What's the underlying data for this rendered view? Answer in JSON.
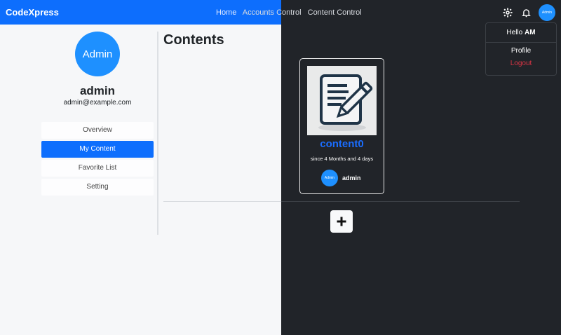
{
  "navbar": {
    "brand": "CodeXpress",
    "links": [
      "Home",
      "Accounts Control",
      "Content Control"
    ],
    "avatar_label": "Admin"
  },
  "dropdown": {
    "greeting_prefix": "Hello",
    "greeting_name": "AM",
    "profile": "Profile",
    "logout": "Logout"
  },
  "profile": {
    "avatar_label": "Admin",
    "name": "admin",
    "email": "admin@example.com"
  },
  "sidebar": {
    "items": [
      {
        "label": "Overview",
        "active": false
      },
      {
        "label": "My Content",
        "active": true
      },
      {
        "label": "Favorite List",
        "active": false
      },
      {
        "label": "Setting",
        "active": false
      }
    ]
  },
  "main": {
    "title": "Contents"
  },
  "cards": [
    {
      "title": "content0",
      "since": "since 4 Months and 4 days",
      "author_avatar": "Admin",
      "author": "admin",
      "thumbnail_icon": "document-pencil-icon"
    }
  ],
  "colors": {
    "primary": "#0d6efd",
    "dark": "#212429",
    "danger": "#dc3545",
    "link": "#1a6dff"
  }
}
